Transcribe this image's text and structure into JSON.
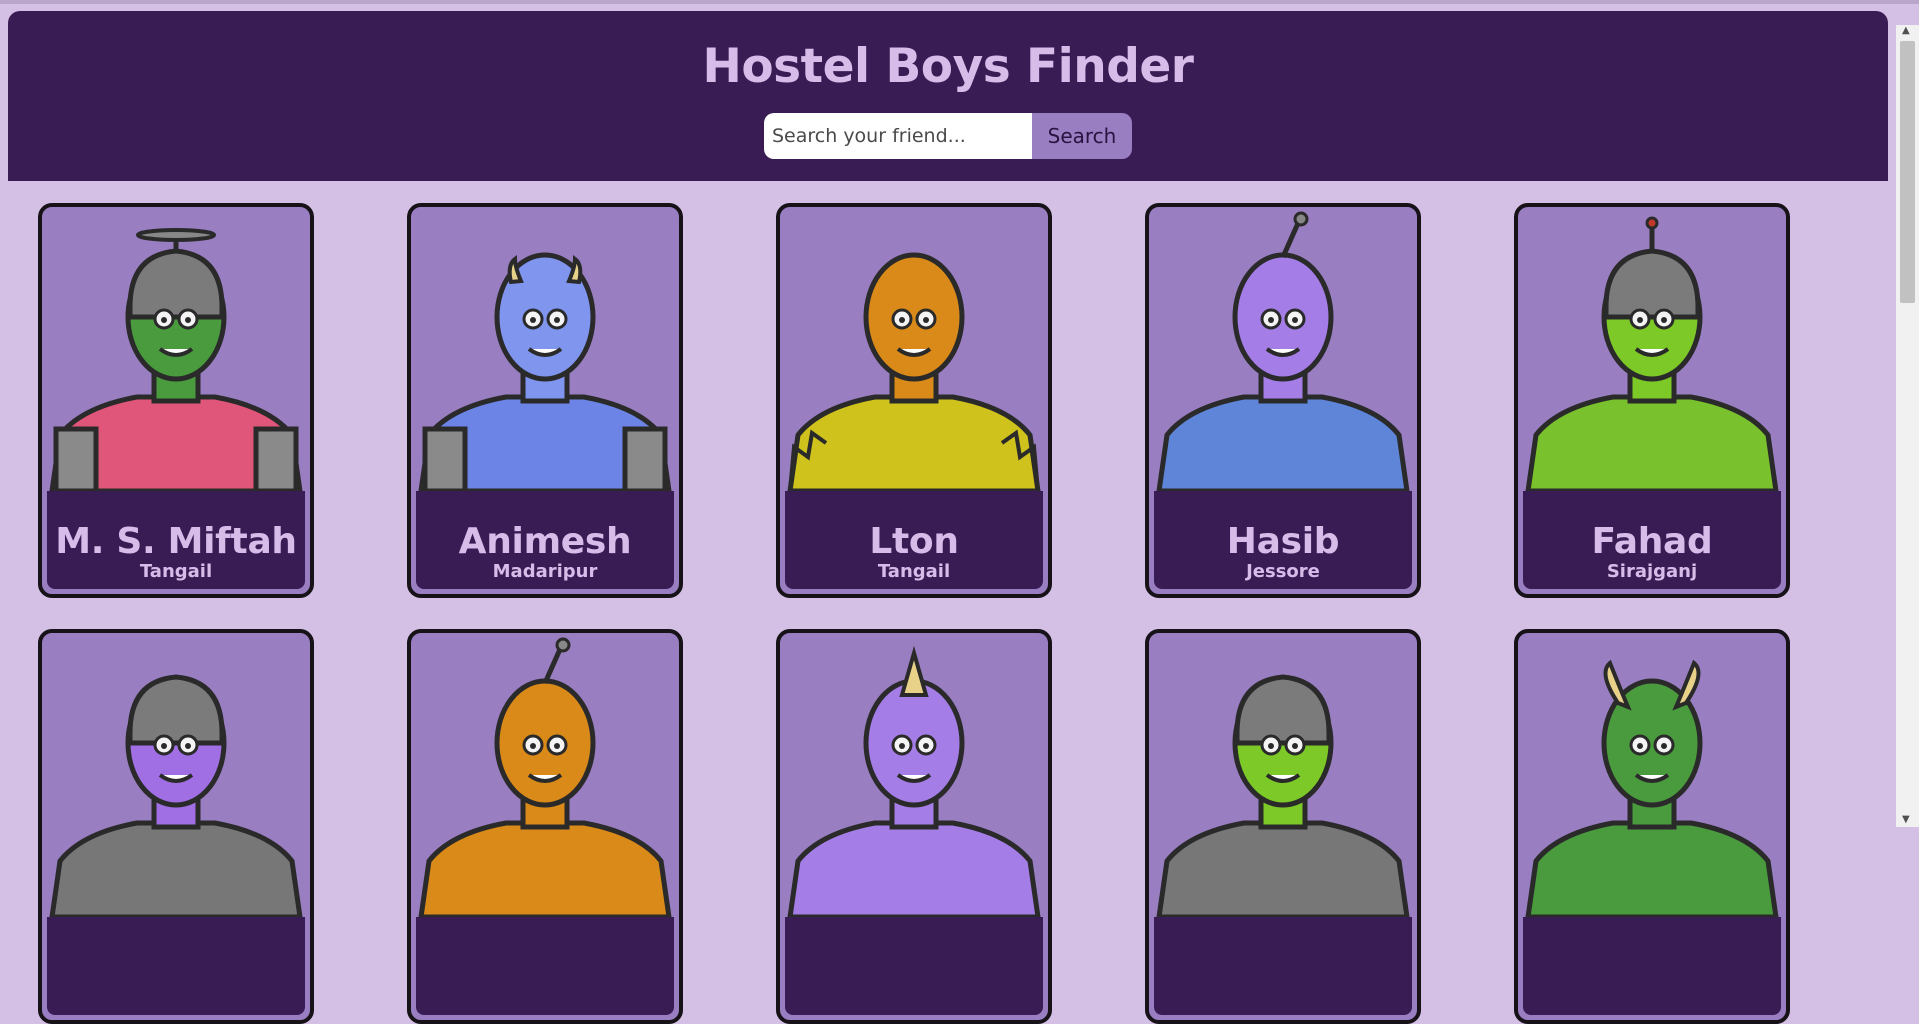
{
  "header": {
    "title": "Hostel Boys Finder",
    "search": {
      "placeholder": "Search your friend...",
      "value": "",
      "button_label": "Search"
    }
  },
  "colors": {
    "header_bg": "#3a1c55",
    "page_bg": "#d5c0e5",
    "card_bg": "#9a7ec2",
    "title_text": "#d7bcea"
  },
  "cards": [
    {
      "name": "M. S. Miftah",
      "location": "Tangail",
      "avatar": "green-robot-propeller-avatar"
    },
    {
      "name": "Animesh",
      "location": "Madaripur",
      "avatar": "blue-horned-monster-avatar"
    },
    {
      "name": "Lton",
      "location": "Tangail",
      "avatar": "orange-spiky-monster-avatar"
    },
    {
      "name": "Hasib",
      "location": "Jessore",
      "avatar": "purple-three-eyed-alien-avatar"
    },
    {
      "name": "Fahad",
      "location": "Sirajganj",
      "avatar": "green-helmet-robot-avatar"
    },
    {
      "name": "",
      "location": "",
      "avatar": "purple-robot-helmet-avatar"
    },
    {
      "name": "",
      "location": "",
      "avatar": "orange-antenna-monster-avatar"
    },
    {
      "name": "",
      "location": "",
      "avatar": "purple-horned-monster-avatar"
    },
    {
      "name": "",
      "location": "",
      "avatar": "green-robot-avatar"
    },
    {
      "name": "",
      "location": "",
      "avatar": "green-horned-monster-avatar"
    }
  ]
}
